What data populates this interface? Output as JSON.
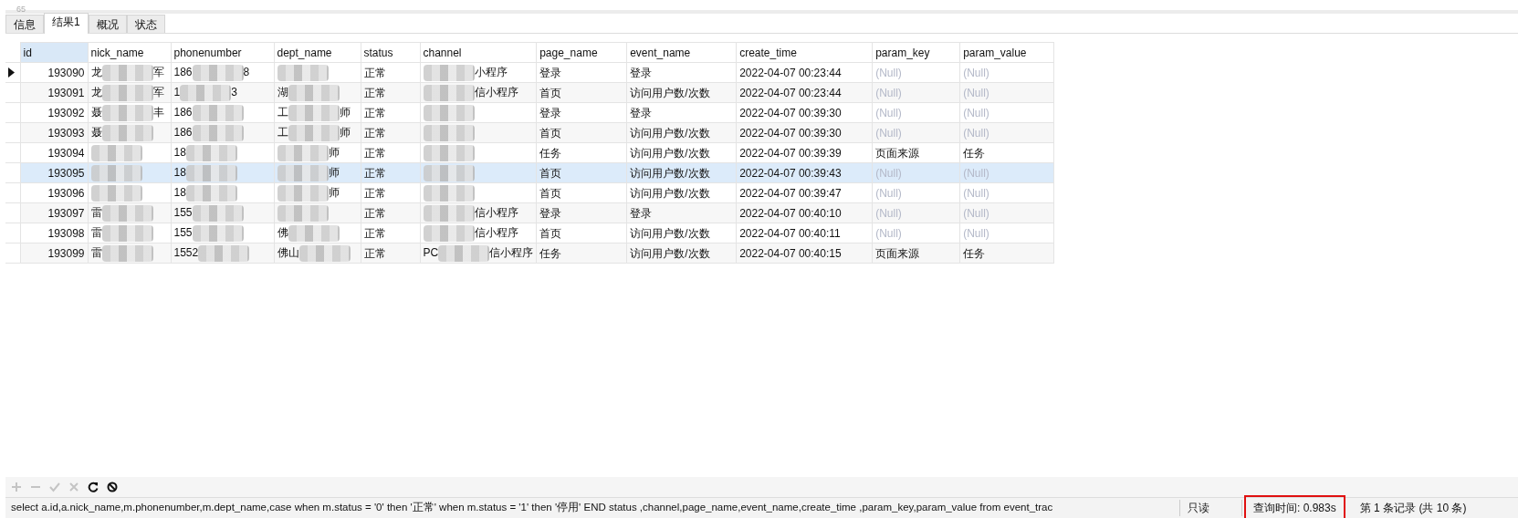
{
  "top_strip": {
    "text": "65"
  },
  "tabs": [
    {
      "label": "信息",
      "selected": false
    },
    {
      "label": "结果1",
      "selected": true
    },
    {
      "label": "概况",
      "selected": false
    },
    {
      "label": "状态",
      "selected": false
    }
  ],
  "grid": {
    "columns": [
      "id",
      "nick_name",
      "phonenumber",
      "dept_name",
      "status",
      "channel",
      "page_name",
      "event_name",
      "create_time",
      "param_key",
      "param_value"
    ],
    "rows": [
      {
        "current": true,
        "highlighted": false,
        "cells": [
          "193090",
          {
            "before": "龙",
            "after": "军"
          },
          {
            "before": "186",
            "after": "8"
          },
          {
            "redacted": true
          },
          "正常",
          {
            "after": "小程序"
          },
          "登录",
          "登录",
          "2022-04-07 00:23:44",
          {
            "text": "(Null)",
            "is_null": true
          },
          {
            "text": "(Null)",
            "is_null": true
          }
        ]
      },
      {
        "current": false,
        "highlighted": false,
        "cells": [
          "193091",
          {
            "before": "龙",
            "after": "军"
          },
          {
            "before": "1",
            "after": "3"
          },
          {
            "before": "湖"
          },
          "正常",
          {
            "after": "信小程序"
          },
          "首页",
          "访问用户数/次数",
          "2022-04-07 00:23:44",
          {
            "text": "(Null)",
            "is_null": true
          },
          {
            "text": "(Null)",
            "is_null": true
          }
        ]
      },
      {
        "current": false,
        "highlighted": false,
        "cells": [
          "193092",
          {
            "before": "聂",
            "after": "丰"
          },
          {
            "before": "186"
          },
          {
            "before": "工",
            "after": "师"
          },
          "正常",
          {
            "redacted": true
          },
          "登录",
          "登录",
          "2022-04-07 00:39:30",
          {
            "text": "(Null)",
            "is_null": true
          },
          {
            "text": "(Null)",
            "is_null": true
          }
        ]
      },
      {
        "current": false,
        "highlighted": false,
        "cells": [
          "193093",
          {
            "before": "聂"
          },
          {
            "before": "186"
          },
          {
            "before": "工",
            "after": "师"
          },
          "正常",
          {
            "redacted": true
          },
          "首页",
          "访问用户数/次数",
          "2022-04-07 00:39:30",
          {
            "text": "(Null)",
            "is_null": true
          },
          {
            "text": "(Null)",
            "is_null": true
          }
        ]
      },
      {
        "current": false,
        "highlighted": false,
        "cells": [
          "193094",
          {
            "redacted": true
          },
          {
            "before": "18"
          },
          {
            "after": "师"
          },
          "正常",
          {
            "redacted": true
          },
          "任务",
          "访问用户数/次数",
          "2022-04-07 00:39:39",
          {
            "text": "页面来源",
            "is_null": false
          },
          {
            "text": "任务",
            "is_null": false
          }
        ]
      },
      {
        "current": false,
        "highlighted": true,
        "cells": [
          "193095",
          {
            "redacted": true
          },
          {
            "before": "18"
          },
          {
            "after": "师"
          },
          "正常",
          {
            "redacted": true
          },
          "首页",
          "访问用户数/次数",
          "2022-04-07 00:39:43",
          {
            "text": "(Null)",
            "is_null": true
          },
          {
            "text": "(Null)",
            "is_null": true
          }
        ]
      },
      {
        "current": false,
        "highlighted": false,
        "cells": [
          "193096",
          {
            "redacted": true
          },
          {
            "before": "18"
          },
          {
            "after": "师"
          },
          "正常",
          {
            "redacted": true
          },
          "首页",
          "访问用户数/次数",
          "2022-04-07 00:39:47",
          {
            "text": "(Null)",
            "is_null": true
          },
          {
            "text": "(Null)",
            "is_null": true
          }
        ]
      },
      {
        "current": false,
        "highlighted": false,
        "cells": [
          "193097",
          {
            "before": "雷"
          },
          {
            "before": "155"
          },
          {
            "redacted": true
          },
          "正常",
          {
            "after": "信小程序"
          },
          "登录",
          "登录",
          "2022-04-07 00:40:10",
          {
            "text": "(Null)",
            "is_null": true
          },
          {
            "text": "(Null)",
            "is_null": true
          }
        ]
      },
      {
        "current": false,
        "highlighted": false,
        "cells": [
          "193098",
          {
            "before": "雷"
          },
          {
            "before": "155"
          },
          {
            "before": "佛"
          },
          "正常",
          {
            "after": "信小程序"
          },
          "首页",
          "访问用户数/次数",
          "2022-04-07 00:40:11",
          {
            "text": "(Null)",
            "is_null": true
          },
          {
            "text": "(Null)",
            "is_null": true
          }
        ]
      },
      {
        "current": false,
        "highlighted": false,
        "cells": [
          "193099",
          {
            "before": "雷"
          },
          {
            "before": "1552"
          },
          {
            "before": "佛山"
          },
          "正常",
          {
            "before": "PC",
            "after": "信小程序"
          },
          "任务",
          "访问用户数/次数",
          "2022-04-07 00:40:15",
          {
            "text": "页面来源",
            "is_null": false
          },
          {
            "text": "任务",
            "is_null": false
          }
        ]
      }
    ]
  },
  "toolbar": [
    {
      "kind": "add",
      "disabled": true
    },
    {
      "kind": "remove",
      "disabled": true
    },
    {
      "kind": "apply",
      "disabled": true
    },
    {
      "kind": "cancel",
      "disabled": true
    },
    {
      "kind": "refresh",
      "disabled": false
    },
    {
      "kind": "stop",
      "disabled": false
    }
  ],
  "status_bar": {
    "sql": "select  a.id,a.nick_name,m.phonenumber,m.dept_name,case when m.status = '0' then '正常' when  m.status = '1' then '停用' END status ,channel,page_name,event_name,create_time ,param_key,param_value  from event_trac",
    "mode": "只读",
    "query_time": {
      "text": "查询时间: 0.983s",
      "highlighted": true
    },
    "record": "第 1 条记录 (共 10 条)"
  }
}
